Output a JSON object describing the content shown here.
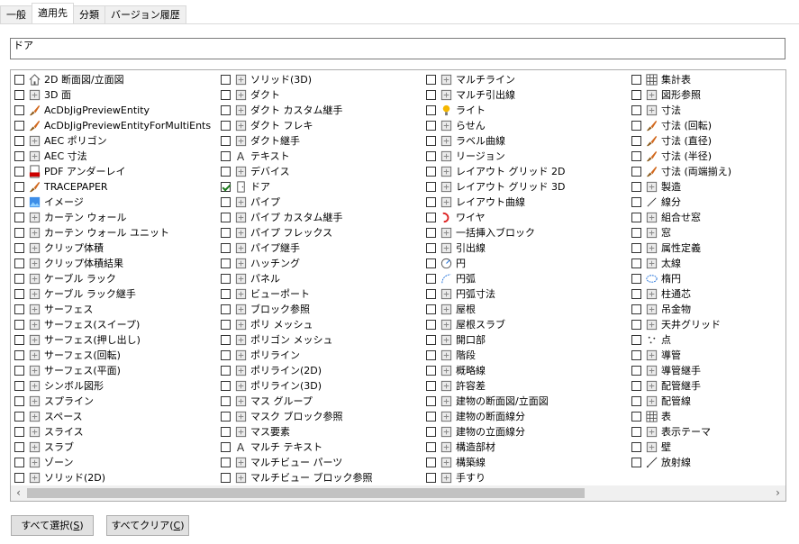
{
  "tabs": [
    "一般",
    "適用先",
    "分類",
    "バージョン履歴"
  ],
  "active_tab": 1,
  "filter": {
    "value": "ドア"
  },
  "columns": [
    [
      {
        "label": "2D 断面図/立面図",
        "icon": "house-outline-icon",
        "checked": false
      },
      {
        "label": "3D 面",
        "icon": "3d-face-icon",
        "checked": false
      },
      {
        "label": "AcDbJigPreviewEntity",
        "icon": "brush-icon",
        "checked": false
      },
      {
        "label": "AcDbJigPreviewEntityForMultiEnts",
        "icon": "brush-icon",
        "checked": false
      },
      {
        "label": "AEC ポリゴン",
        "icon": "polygon-icon",
        "checked": false
      },
      {
        "label": "AEC 寸法",
        "icon": "aec-dimension-icon",
        "checked": false
      },
      {
        "label": "PDF アンダーレイ",
        "icon": "pdf-icon",
        "checked": false
      },
      {
        "label": "TRACEPAPER",
        "icon": "brush-icon",
        "checked": false
      },
      {
        "label": "イメージ",
        "icon": "image-icon",
        "checked": false
      },
      {
        "label": "カーテン ウォール",
        "icon": "curtain-wall-icon",
        "checked": false
      },
      {
        "label": "カーテン ウォール ユニット",
        "icon": "curtain-wall-unit-icon",
        "checked": false
      },
      {
        "label": "クリップ体積",
        "icon": "clip-volume-icon",
        "checked": false
      },
      {
        "label": "クリップ体積結果",
        "icon": "clip-volume-result-icon",
        "checked": false
      },
      {
        "label": "ケーブル ラック",
        "icon": "cable-tray-icon",
        "checked": false
      },
      {
        "label": "ケーブル ラック継手",
        "icon": "cable-tray-fitting-icon",
        "checked": false
      },
      {
        "label": "サーフェス",
        "icon": "surface-icon",
        "checked": false
      },
      {
        "label": "サーフェス(スイープ)",
        "icon": "surface-sweep-icon",
        "checked": false
      },
      {
        "label": "サーフェス(押し出し)",
        "icon": "surface-extrude-icon",
        "checked": false
      },
      {
        "label": "サーフェス(回転)",
        "icon": "surface-revolve-icon",
        "checked": false
      },
      {
        "label": "サーフェス(平面)",
        "icon": "surface-planar-icon",
        "checked": false
      },
      {
        "label": "シンボル図形",
        "icon": "symbol-icon",
        "checked": false
      },
      {
        "label": "スプライン",
        "icon": "spline-icon",
        "checked": false
      },
      {
        "label": "スペース",
        "icon": "space-icon",
        "checked": false
      },
      {
        "label": "スライス",
        "icon": "slice-icon",
        "checked": false
      },
      {
        "label": "スラブ",
        "icon": "slab-icon",
        "checked": false
      },
      {
        "label": "ゾーン",
        "icon": "zone-icon",
        "checked": false
      },
      {
        "label": "ソリッド(2D)",
        "icon": "solid-2d-icon",
        "checked": false
      }
    ],
    [
      {
        "label": "ソリッド(3D)",
        "icon": "solid-3d-icon",
        "checked": false
      },
      {
        "label": "ダクト",
        "icon": "duct-icon",
        "checked": false
      },
      {
        "label": "ダクト カスタム継手",
        "icon": "duct-custom-fitting-icon",
        "checked": false
      },
      {
        "label": "ダクト フレキ",
        "icon": "duct-flex-icon",
        "checked": false
      },
      {
        "label": "ダクト継手",
        "icon": "duct-fitting-icon",
        "checked": false
      },
      {
        "label": "テキスト",
        "icon": "text-icon",
        "checked": false
      },
      {
        "label": "デバイス",
        "icon": "device-icon",
        "checked": false
      },
      {
        "label": "ドア",
        "icon": "door-icon",
        "checked": true
      },
      {
        "label": "パイプ",
        "icon": "pipe-icon",
        "checked": false
      },
      {
        "label": "パイプ カスタム継手",
        "icon": "pipe-custom-fitting-icon",
        "checked": false
      },
      {
        "label": "パイプ フレックス",
        "icon": "pipe-flex-icon",
        "checked": false
      },
      {
        "label": "パイプ継手",
        "icon": "pipe-fitting-icon",
        "checked": false
      },
      {
        "label": "ハッチング",
        "icon": "hatch-icon",
        "checked": false
      },
      {
        "label": "パネル",
        "icon": "panel-icon",
        "checked": false
      },
      {
        "label": "ビューポート",
        "icon": "viewport-icon",
        "checked": false
      },
      {
        "label": "ブロック参照",
        "icon": "block-reference-icon",
        "checked": false
      },
      {
        "label": "ポリ メッシュ",
        "icon": "poly-mesh-icon",
        "checked": false
      },
      {
        "label": "ポリゴン メッシュ",
        "icon": "polygon-mesh-icon",
        "checked": false
      },
      {
        "label": "ポリライン",
        "icon": "polyline-icon",
        "checked": false
      },
      {
        "label": "ポリライン(2D)",
        "icon": "polyline-2d-icon",
        "checked": false
      },
      {
        "label": "ポリライン(3D)",
        "icon": "polyline-3d-icon",
        "checked": false
      },
      {
        "label": "マス グループ",
        "icon": "mass-group-icon",
        "checked": false
      },
      {
        "label": "マスク ブロック参照",
        "icon": "mask-block-icon",
        "checked": false
      },
      {
        "label": "マス要素",
        "icon": "mass-element-icon",
        "checked": false
      },
      {
        "label": "マルチ テキスト",
        "icon": "mtext-icon",
        "checked": false
      },
      {
        "label": "マルチビュー パーツ",
        "icon": "multiview-part-icon",
        "checked": false
      },
      {
        "label": "マルチビュー ブロック参照",
        "icon": "multiview-block-icon",
        "checked": false
      }
    ],
    [
      {
        "label": "マルチライン",
        "icon": "multiline-icon",
        "checked": false
      },
      {
        "label": "マルチ引出線",
        "icon": "multileader-icon",
        "checked": false
      },
      {
        "label": "ライト",
        "icon": "light-icon",
        "checked": false
      },
      {
        "label": "らせん",
        "icon": "helix-icon",
        "checked": false
      },
      {
        "label": "ラベル曲線",
        "icon": "label-curve-icon",
        "checked": false
      },
      {
        "label": "リージョン",
        "icon": "region-icon",
        "checked": false
      },
      {
        "label": "レイアウト グリッド 2D",
        "icon": "layout-grid-2d-icon",
        "checked": false
      },
      {
        "label": "レイアウト グリッド 3D",
        "icon": "layout-grid-3d-icon",
        "checked": false
      },
      {
        "label": "レイアウト曲線",
        "icon": "layout-curve-icon",
        "checked": false
      },
      {
        "label": "ワイヤ",
        "icon": "wire-icon",
        "checked": false
      },
      {
        "label": "一括挿入ブロック",
        "icon": "minsert-block-icon",
        "checked": false
      },
      {
        "label": "引出線",
        "icon": "leader-icon",
        "checked": false
      },
      {
        "label": "円",
        "icon": "circle-icon",
        "checked": false
      },
      {
        "label": "円弧",
        "icon": "arc-icon",
        "checked": false
      },
      {
        "label": "円弧寸法",
        "icon": "arc-dimension-icon",
        "checked": false
      },
      {
        "label": "屋根",
        "icon": "roof-icon",
        "checked": false
      },
      {
        "label": "屋根スラブ",
        "icon": "roof-slab-icon",
        "checked": false
      },
      {
        "label": "開口部",
        "icon": "opening-icon",
        "checked": false
      },
      {
        "label": "階段",
        "icon": "stair-icon",
        "checked": false
      },
      {
        "label": "概略線",
        "icon": "schematic-line-icon",
        "checked": false
      },
      {
        "label": "許容差",
        "icon": "tolerance-icon",
        "checked": false
      },
      {
        "label": "建物の断面図/立面図",
        "icon": "building-section-icon",
        "checked": false
      },
      {
        "label": "建物の断面線分",
        "icon": "building-section-line-icon",
        "checked": false
      },
      {
        "label": "建物の立面線分",
        "icon": "building-elevation-line-icon",
        "checked": false
      },
      {
        "label": "構造部材",
        "icon": "structural-member-icon",
        "checked": false
      },
      {
        "label": "構築線",
        "icon": "construction-line-icon",
        "checked": false
      },
      {
        "label": "手すり",
        "icon": "railing-icon",
        "checked": false
      }
    ],
    [
      {
        "label": "集計表",
        "icon": "schedule-table-icon",
        "checked": false
      },
      {
        "label": "図形参照",
        "icon": "shape-reference-icon",
        "checked": false
      },
      {
        "label": "寸法",
        "icon": "dimension-icon",
        "checked": false
      },
      {
        "label": "寸法 (回転)",
        "icon": "brush-icon",
        "checked": false
      },
      {
        "label": "寸法 (直径)",
        "icon": "brush-icon",
        "checked": false
      },
      {
        "label": "寸法 (半径)",
        "icon": "brush-icon",
        "checked": false
      },
      {
        "label": "寸法 (両端揃え)",
        "icon": "brush-icon",
        "checked": false
      },
      {
        "label": "製造",
        "icon": "fabrication-icon",
        "checked": false
      },
      {
        "label": "線分",
        "icon": "line-icon",
        "checked": false
      },
      {
        "label": "組合せ窓",
        "icon": "window-assembly-icon",
        "checked": false
      },
      {
        "label": "窓",
        "icon": "window-icon",
        "checked": false
      },
      {
        "label": "属性定義",
        "icon": "attribute-icon",
        "checked": false
      },
      {
        "label": "太線",
        "icon": "trace-icon",
        "checked": false
      },
      {
        "label": "楕円",
        "icon": "ellipse-icon",
        "checked": false
      },
      {
        "label": "柱通芯",
        "icon": "column-grid-icon",
        "checked": false
      },
      {
        "label": "吊金物",
        "icon": "hanger-icon",
        "checked": false
      },
      {
        "label": "天井グリッド",
        "icon": "ceiling-grid-icon",
        "checked": false
      },
      {
        "label": "点",
        "icon": "point-icon",
        "checked": false
      },
      {
        "label": "導管",
        "icon": "conduit-icon",
        "checked": false
      },
      {
        "label": "導管継手",
        "icon": "conduit-fitting-icon",
        "checked": false
      },
      {
        "label": "配管継手",
        "icon": "pipe-joint-icon",
        "checked": false
      },
      {
        "label": "配管線",
        "icon": "pipe-line-icon",
        "checked": false
      },
      {
        "label": "表",
        "icon": "table-icon",
        "checked": false
      },
      {
        "label": "表示テーマ",
        "icon": "display-theme-icon",
        "checked": false
      },
      {
        "label": "壁",
        "icon": "wall-icon",
        "checked": false
      },
      {
        "label": "放射線",
        "icon": "ray-icon",
        "checked": false
      }
    ]
  ],
  "buttons": {
    "select_all": {
      "label": "すべて選択(",
      "mnemonic": "S",
      "suffix": ")"
    },
    "clear_all": {
      "label": "すべてクリア(",
      "mnemonic": "C",
      "suffix": ")"
    }
  },
  "scrollbar": {
    "left_arrow": "‹",
    "right_arrow": "›"
  }
}
